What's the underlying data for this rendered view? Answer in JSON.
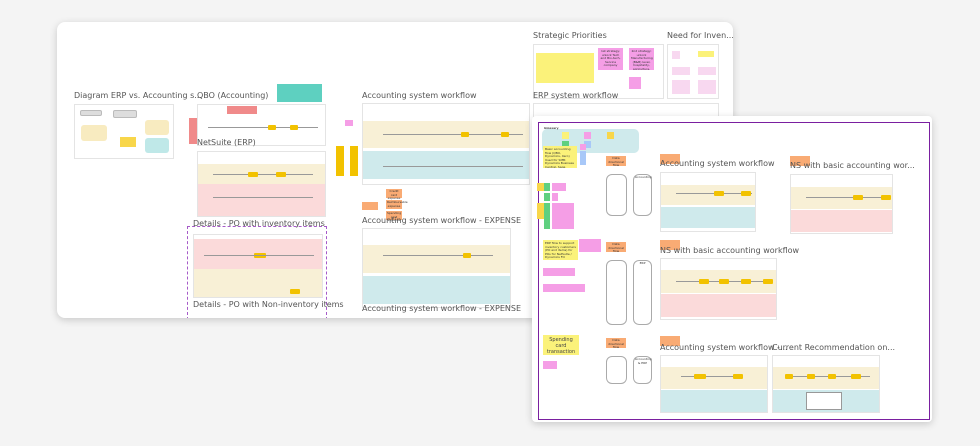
{
  "back_board": {
    "frames": {
      "diagram_erp": "Diagram ERP vs. Accounting s...",
      "qbo": "QBO (Accounting)",
      "netsuite": "NetSuite (ERP)",
      "details_inventory": "Details - PO with inventory items",
      "details_non_inventory": "Details - PO with Non-inventory items",
      "acct_workflow": "Accounting system workflow",
      "acct_expense": "Accounting system workflow - EXPENSE",
      "acct_expense_2": "Accounting system workflow - EXPENSE",
      "strategic": "Strategic Priorities",
      "need_inventory": "Need for Inven...",
      "erp_workflow": "ERP system workflow"
    },
    "stickies": {
      "strategic_1": "1st strategy: unlock Tech and Bio-tech, Service company",
      "strategic_2": "2nd strategy: unlock Manufacturing (B&B) level, hospitality, agriculture, durable cpm",
      "expense_orange_1": "Credit card expense",
      "expense_orange_2": "Reimbursable expense",
      "expense_orange_3": "Spending card expense"
    }
  },
  "front_board": {
    "legend_title": "Glossary",
    "frames": {
      "acct_workflow": "Accounting system workflow",
      "ns_basic_short": "NS with basic accounting wor...",
      "ns_basic": "NS with basic accounting workflow",
      "acct_workflow_short": "Accounting system workflow -...",
      "current_rec": "Current Recommendation on..."
    },
    "notes": {
      "basic_flow": "Basic accounting flow (QBO, Dynamics, Xero) Used for SMB: Dynamics Business Central, Sage Intacct, NetSuite, Dynamics Financials",
      "erp_flow": "ERP flow to support inventory customers (PO and items) for POs for NetSuite / Dynamics FO",
      "spending_card": "Spending card transaction"
    },
    "orange_labels": {
      "flow_1": "Data directional flow",
      "flow_2": "Data directional flow",
      "flow_3": "Data directional flow",
      "accounting": "Accounting",
      "erp": "ERP",
      "acct_erp": "Accounting & ERP"
    }
  },
  "colors": {
    "accent_purple": "#7a1fa0",
    "yellow_lane": "#f8f0d6",
    "pink_lane": "#fbdada",
    "teal_lane": "#cfeaec",
    "gold": "#f2c200",
    "orange": "#f9ab74",
    "magenta": "#f59ee6"
  }
}
